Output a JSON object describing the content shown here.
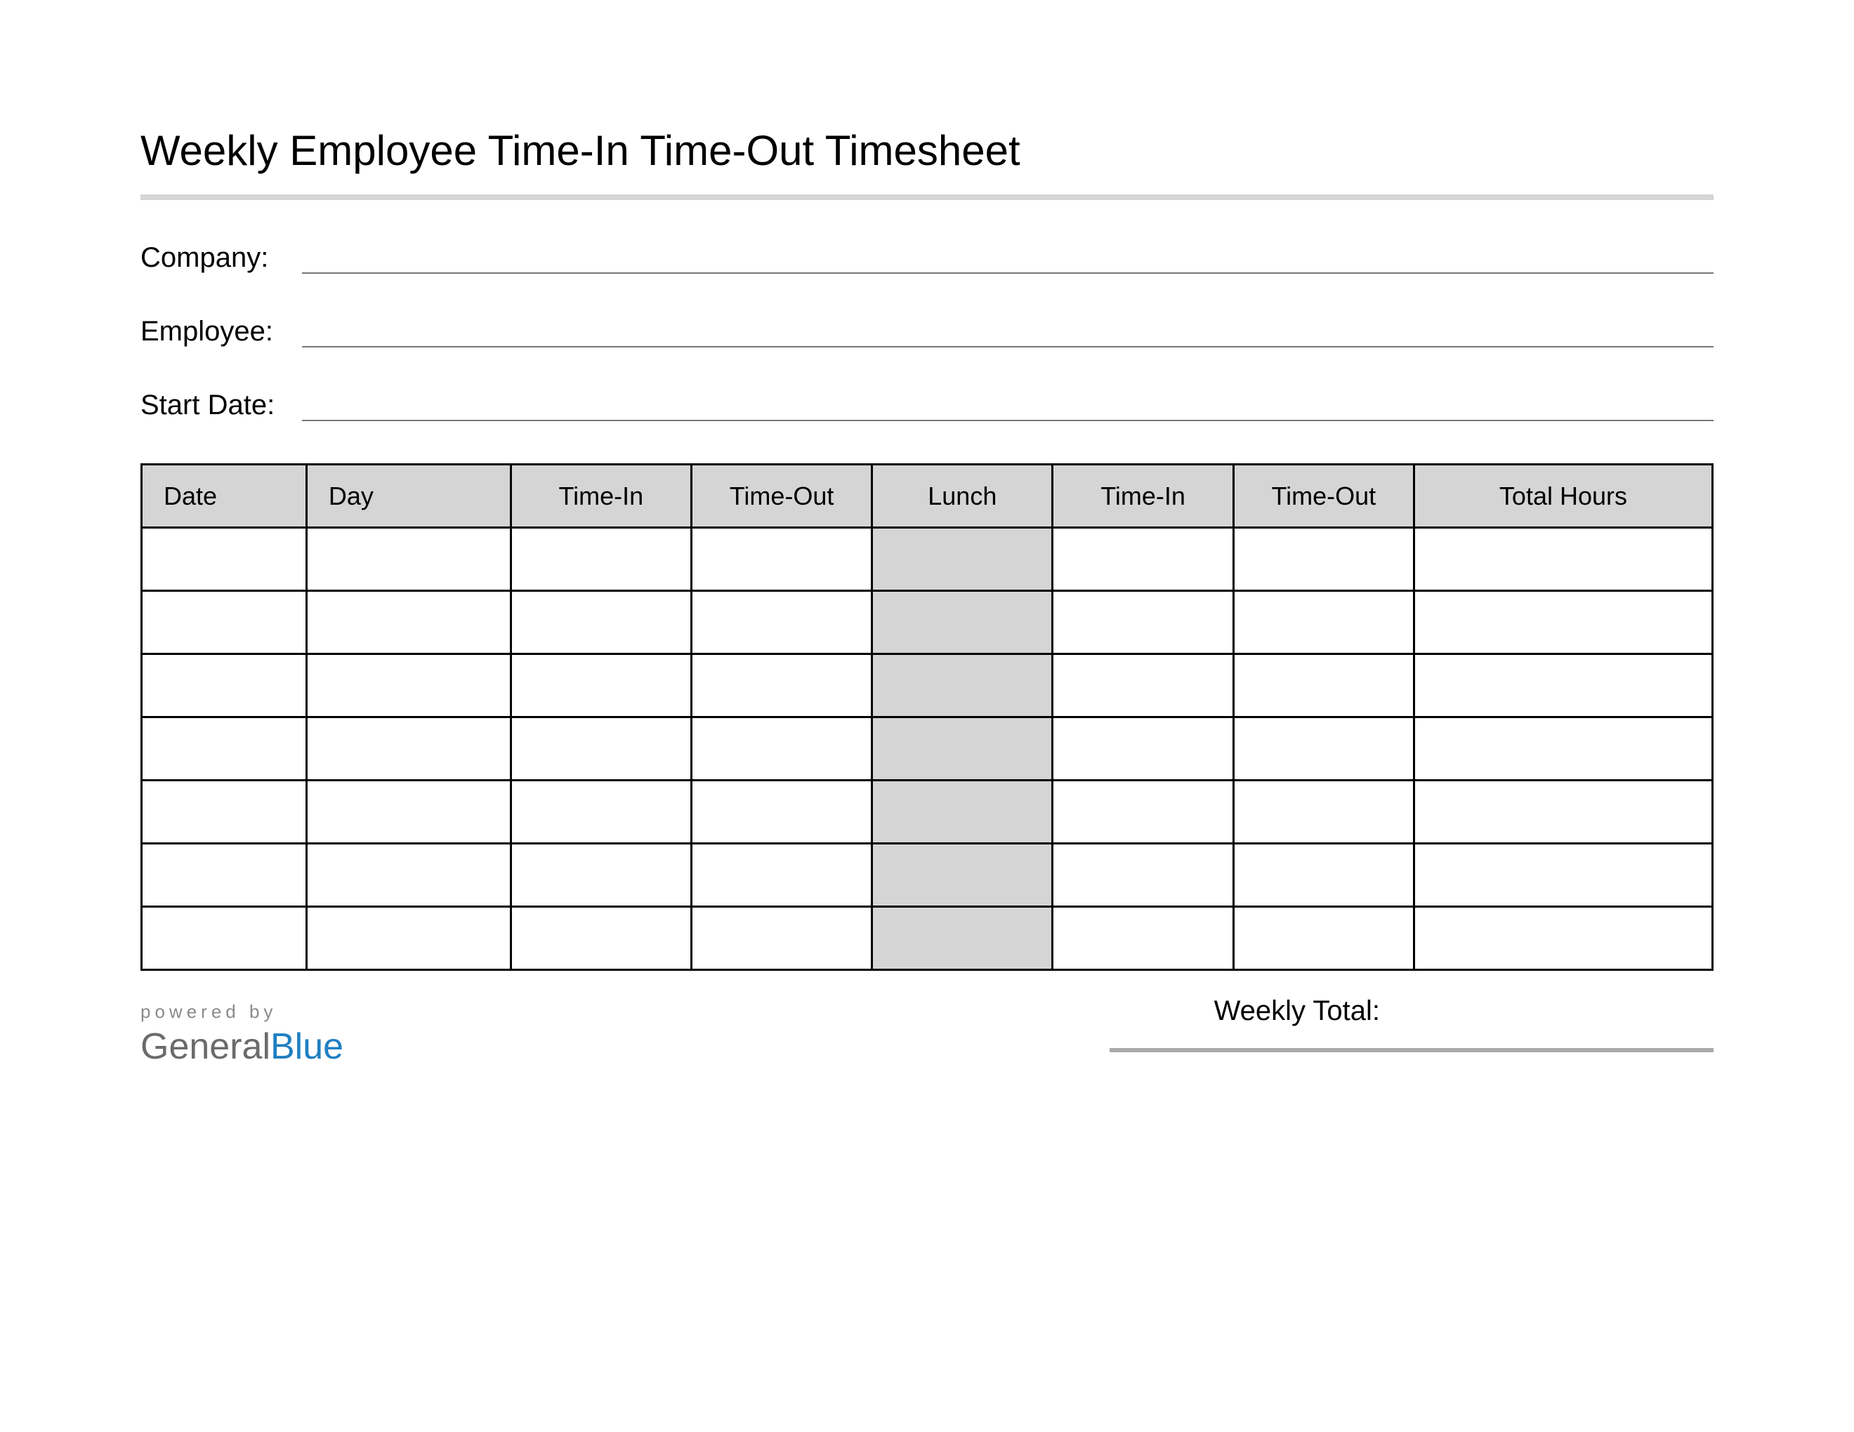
{
  "title": "Weekly Employee Time-In Time-Out Timesheet",
  "meta": {
    "company_label": "Company:",
    "employee_label": "Employee:",
    "start_date_label": "Start Date:",
    "company_value": "",
    "employee_value": "",
    "start_date_value": ""
  },
  "table": {
    "headers": {
      "date": "Date",
      "day": "Day",
      "time_in_1": "Time-In",
      "time_out_1": "Time-Out",
      "lunch": "Lunch",
      "time_in_2": "Time-In",
      "time_out_2": "Time-Out",
      "total_hours": "Total Hours"
    },
    "rows": [
      {
        "date": "",
        "day": "",
        "time_in_1": "",
        "time_out_1": "",
        "lunch": "",
        "time_in_2": "",
        "time_out_2": "",
        "total_hours": ""
      },
      {
        "date": "",
        "day": "",
        "time_in_1": "",
        "time_out_1": "",
        "lunch": "",
        "time_in_2": "",
        "time_out_2": "",
        "total_hours": ""
      },
      {
        "date": "",
        "day": "",
        "time_in_1": "",
        "time_out_1": "",
        "lunch": "",
        "time_in_2": "",
        "time_out_2": "",
        "total_hours": ""
      },
      {
        "date": "",
        "day": "",
        "time_in_1": "",
        "time_out_1": "",
        "lunch": "",
        "time_in_2": "",
        "time_out_2": "",
        "total_hours": ""
      },
      {
        "date": "",
        "day": "",
        "time_in_1": "",
        "time_out_1": "",
        "lunch": "",
        "time_in_2": "",
        "time_out_2": "",
        "total_hours": ""
      },
      {
        "date": "",
        "day": "",
        "time_in_1": "",
        "time_out_1": "",
        "lunch": "",
        "time_in_2": "",
        "time_out_2": "",
        "total_hours": ""
      },
      {
        "date": "",
        "day": "",
        "time_in_1": "",
        "time_out_1": "",
        "lunch": "",
        "time_in_2": "",
        "time_out_2": "",
        "total_hours": ""
      }
    ]
  },
  "footer": {
    "powered_by": "powered by",
    "brand_general": "General",
    "brand_blue": "Blue",
    "weekly_total_label": "Weekly Total:",
    "weekly_total_value": ""
  }
}
